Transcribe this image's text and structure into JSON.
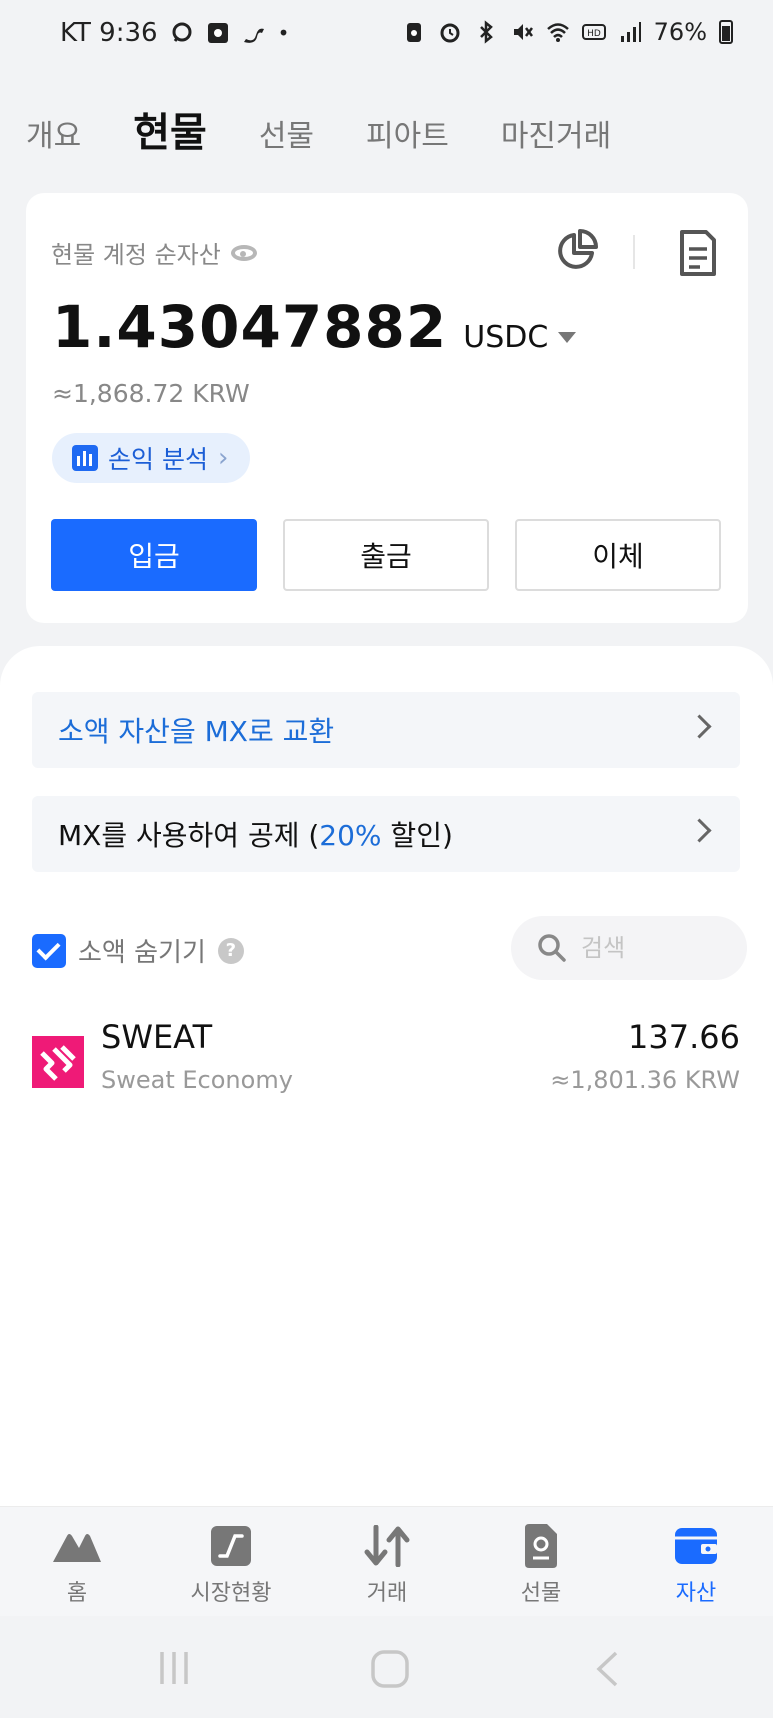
{
  "status_bar": {
    "carrier_time": "KT 9:36",
    "battery": "76%"
  },
  "tabs": [
    {
      "label": "개요"
    },
    {
      "label": "현물"
    },
    {
      "label": "선물"
    },
    {
      "label": "피아트"
    },
    {
      "label": "마진거래"
    }
  ],
  "active_tab": "현물",
  "account": {
    "label": "현물 계정 순자산",
    "balance": "1.43047882",
    "currency": "USDC",
    "fiat_value": "≈1,868.72 KRW",
    "pnl_label": "손익 분석"
  },
  "actions": {
    "deposit": "입금",
    "withdraw": "출금",
    "transfer": "이체"
  },
  "promos": {
    "convert": "소액 자산을 MX로 교환",
    "deduct_prefix": "MX를 사용하여 공제 (",
    "deduct_pct": "20%",
    "deduct_suffix": " 할인)"
  },
  "filter": {
    "hide_small_label": "소액 숨기기",
    "hide_small_checked": true,
    "search_placeholder": "검색"
  },
  "assets": [
    {
      "symbol": "SWEAT",
      "name": "Sweat Economy",
      "quantity": "137.66",
      "value": "≈1,801.36 KRW"
    }
  ],
  "bottom_nav": [
    {
      "label": "홈",
      "icon": "home-mountain-icon"
    },
    {
      "label": "시장현황",
      "icon": "market-chart-icon"
    },
    {
      "label": "거래",
      "icon": "trade-arrows-icon"
    },
    {
      "label": "선물",
      "icon": "futures-doc-icon"
    },
    {
      "label": "자산",
      "icon": "wallet-icon"
    }
  ],
  "active_nav": "자산",
  "colors": {
    "accent": "#1a6bff",
    "link_blue": "#1c6dd8",
    "sweat_pink": "#ef1a77"
  }
}
